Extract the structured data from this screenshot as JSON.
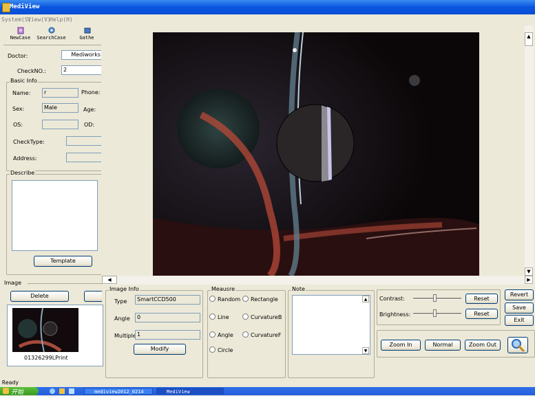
{
  "app": {
    "title": "MediView"
  },
  "menu": [
    "System(S)",
    "View(V)",
    "Help(H)"
  ],
  "toolbar": {
    "items": [
      "NewCase",
      "SearchCase",
      "Gathe"
    ]
  },
  "patient": {
    "doctor_label": "Doctor:",
    "doctor_value": "Mediworks",
    "checkno_label": "CheckNO.:",
    "checkno_value": "2",
    "basic_info_title": "Basic Info",
    "name_label": "Name:",
    "name_value": "r",
    "phone_label": "Phone:",
    "sex_label": "Sex:",
    "sex_value": "Male",
    "age_label": "Age:",
    "os_label": "OS:",
    "od_label": "OD:",
    "checktype_label": "CheckType:",
    "address_label": "Address:",
    "describe_title": "Describe",
    "template_label": "Template"
  },
  "image_section": {
    "title": "Image",
    "delete_label": "Delete",
    "thumb_caption": "01326299LPrint"
  },
  "image_info": {
    "title": "Image Info",
    "type_label": "Type",
    "type_value": "SmartCCD500",
    "angle_label": "Angle",
    "angle_value": "0",
    "multiple_label": "Multiple",
    "multiple_value": "1",
    "modify_label": "Modify"
  },
  "measure": {
    "title": "Meausre",
    "options": [
      "Random",
      "Rectangle",
      "Line",
      "CurvatureB",
      "Angle",
      "CurvatureF",
      "Circle"
    ]
  },
  "note": {
    "title": "Note"
  },
  "adjust": {
    "contrast_label": "Contrast:",
    "brightness_label": "Brightness:",
    "reset_label": "Reset",
    "contrast_level": 0.45,
    "brightness_level": 0.45
  },
  "actions": {
    "revert": "Revert",
    "save": "Save",
    "exit": "Exit"
  },
  "zoom": {
    "zoom_in": "Zoom In",
    "normal": "Normal",
    "zoom_out": "Zoom Out"
  },
  "status": {
    "text": "Ready"
  },
  "taskbar": {
    "start": "开始",
    "tasks": [
      "mediview2012_0214",
      "MediView"
    ]
  },
  "colors": {
    "title_bar": "#0a55e0",
    "taskbar": "#245edb",
    "start": "#3a9a24"
  }
}
